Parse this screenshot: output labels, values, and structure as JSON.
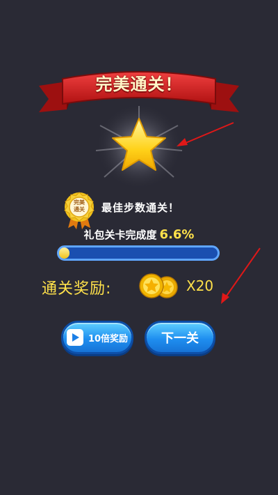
{
  "banner": {
    "title": "完美通关！"
  },
  "medal": {
    "line1": "完美",
    "line2": "通关"
  },
  "best_steps_text": "最佳步数通关！",
  "progress": {
    "label": "礼包关卡完成度",
    "percent_text": "6.6%",
    "value": 0.066
  },
  "reward": {
    "label": "通关奖励:",
    "count": "X20"
  },
  "buttons": {
    "video": "10倍奖励",
    "next": "下一关"
  },
  "colors": {
    "background": "#2a2a35",
    "banner_red": "#d11f1f",
    "gold": "#ffe14a",
    "button_blue": "#1f8ff0",
    "arrow_red": "#e01818"
  }
}
